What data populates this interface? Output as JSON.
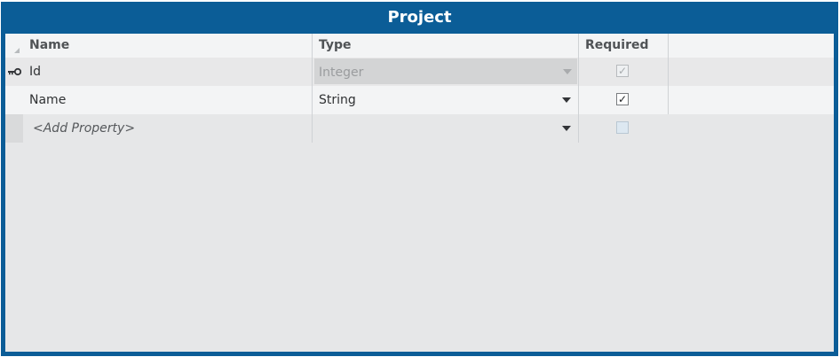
{
  "entity": {
    "title": "Project"
  },
  "columns": {
    "name": "Name",
    "type": "Type",
    "required": "Required"
  },
  "rows": [
    {
      "name": "Id",
      "type": "Integer",
      "required": true,
      "key": true,
      "editable": false
    },
    {
      "name": "Name",
      "type": "String",
      "required": true,
      "key": false,
      "editable": true
    }
  ],
  "add_row": {
    "placeholder": "<Add Property>",
    "type": "",
    "required": false
  },
  "colors": {
    "title_bar": "#0b5d97",
    "grid_background": "#e6e7e8"
  },
  "icons": {
    "key": "key-icon",
    "dropdown": "chevron-down-icon",
    "checkbox": "checkbox-icon",
    "sort": "sort-indicator-icon"
  }
}
